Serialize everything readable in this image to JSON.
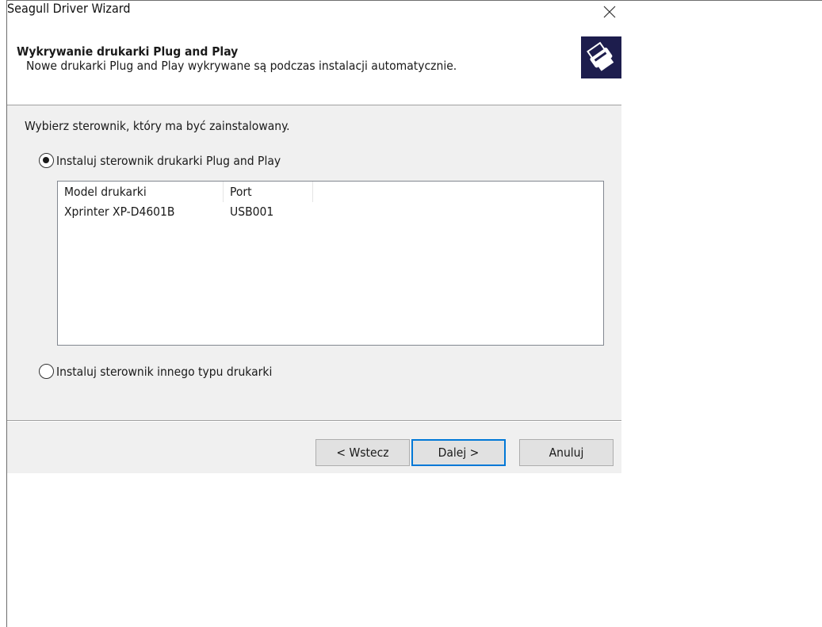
{
  "window": {
    "title": "Seagull Driver Wizard",
    "close_icon": "close-x-icon"
  },
  "header": {
    "title": "Wykrywanie drukarki Plug and Play",
    "subtitle": "Nowe drukarki Plug and Play wykrywane są podczas instalacji automatycznie.",
    "logo_icon": "printer-icon",
    "logo_bg": "#1d1d4d"
  },
  "body": {
    "prompt": "Wybierz sterownik, który ma być zainstalowany.",
    "option_pnp": {
      "label": "Instaluj sterownik drukarki Plug and Play",
      "checked": true
    },
    "option_other": {
      "label": "Instaluj sterownik innego typu drukarki",
      "checked": false
    }
  },
  "printer_list": {
    "columns": [
      "Model drukarki",
      "Port"
    ],
    "rows": [
      [
        "Xprinter XP-D4601B",
        "USB001"
      ]
    ]
  },
  "buttons": {
    "back": "< Wstecz",
    "next": "Dalej >",
    "cancel": "Anuluj"
  },
  "colors": {
    "dialog_bg": "#f0f0f0",
    "default_button_border": "#0078d7"
  }
}
